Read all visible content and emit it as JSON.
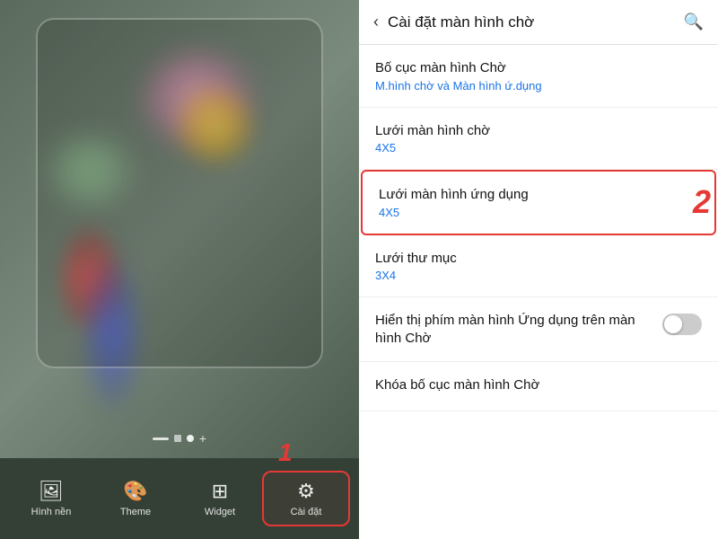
{
  "left": {
    "nav": {
      "items": [
        {
          "id": "hinh-nen",
          "label": "Hình nền",
          "icon": "🖼"
        },
        {
          "id": "theme",
          "label": "Theme",
          "icon": "🎨"
        },
        {
          "id": "widget",
          "label": "Widget",
          "icon": "⊞"
        },
        {
          "id": "cai-dat",
          "label": "Cài đặt",
          "icon": "⚙",
          "active": true
        }
      ]
    },
    "badge": "1"
  },
  "right": {
    "header": {
      "title": "Cài đặt màn hình chờ",
      "back_icon": "‹",
      "search_icon": "🔍"
    },
    "items": [
      {
        "id": "bo-cuc",
        "title": "Bố cục màn hình Chờ",
        "subtitle": "M.hình chờ và Màn hình ứ.dụng",
        "highlighted": false
      },
      {
        "id": "luoi-man-hinh",
        "title": "Lưới màn hình chờ",
        "subtitle": "4X5",
        "highlighted": false
      },
      {
        "id": "luoi-ung-dung",
        "title": "Lưới màn hình ứng dụng",
        "subtitle": "4X5",
        "highlighted": true,
        "badge": "2"
      },
      {
        "id": "luoi-thu-muc",
        "title": "Lưới thư mục",
        "subtitle": "3X4",
        "highlighted": false
      }
    ],
    "toggle_item": {
      "id": "hien-thi-phim",
      "title": "Hiển thị phím màn hình Ứng dụng trên màn hình Chờ",
      "enabled": false
    },
    "last_item": {
      "id": "khoa-bo-cuc",
      "title": "Khóa bố cục màn hình Chờ"
    }
  }
}
